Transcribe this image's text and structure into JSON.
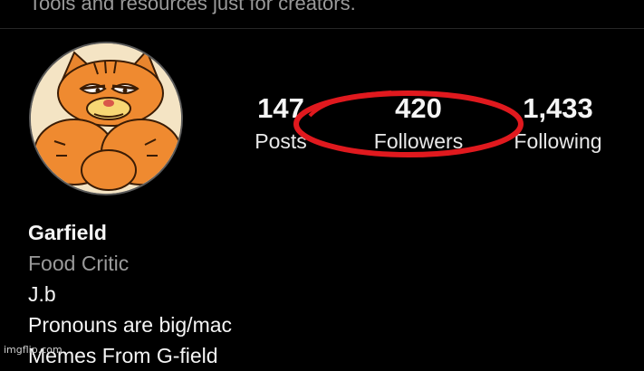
{
  "header": {
    "banner_text": "Tools and resources just for creators."
  },
  "profile": {
    "avatar_icon": "garfield-avatar-icon",
    "stats": [
      {
        "value": "147",
        "label": "Posts"
      },
      {
        "value": "420",
        "label": "Followers"
      },
      {
        "value": "1,433",
        "label": "Following"
      }
    ],
    "name": "Garfield",
    "category": "Food Critic",
    "bio_lines": [
      "J.b",
      "Pronouns are big/mac",
      "Memes From G-field"
    ]
  },
  "annotation": {
    "shape": "ellipse",
    "color": "#e0191e"
  },
  "watermark": "imgflip.com",
  "colors": {
    "background": "#000000",
    "muted_text": "#9a9a9a",
    "highlight": "#e0191e"
  }
}
